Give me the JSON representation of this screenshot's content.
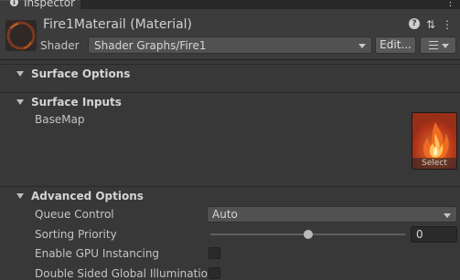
{
  "tab": {
    "label": "Inspector",
    "info_icon": "info-icon",
    "menu_icon": "kebab-menu-icon"
  },
  "header": {
    "title": "Fire1Materail (Material)",
    "shader_label": "Shader",
    "shader_value": "Shader Graphs/Fire1",
    "edit_label": "Edit...",
    "icons": [
      "help-icon",
      "settings-sliders-icon",
      "kebab-menu-icon"
    ]
  },
  "sections": {
    "surface_options": "Surface Options",
    "surface_inputs": "Surface Inputs",
    "advanced_options": "Advanced Options"
  },
  "surface_inputs": {
    "basemap_label": "BaseMap",
    "select_label": "Select"
  },
  "advanced": {
    "queue_control_label": "Queue Control",
    "queue_control_value": "Auto",
    "sorting_priority_label": "Sorting Priority",
    "sorting_priority_value": "0",
    "sorting_priority_fraction": 0.5,
    "gpu_instancing_label": "Enable GPU Instancing",
    "gpu_instancing_checked": false,
    "double_sided_gi_label": "Double Sided Global Illumination",
    "double_sided_gi_checked": false
  },
  "colors": {
    "panel_bg": "#383838",
    "header_bg": "#3c3c3c",
    "fire_orange": "#e25a1c",
    "fire_yellow": "#ffd27a"
  }
}
